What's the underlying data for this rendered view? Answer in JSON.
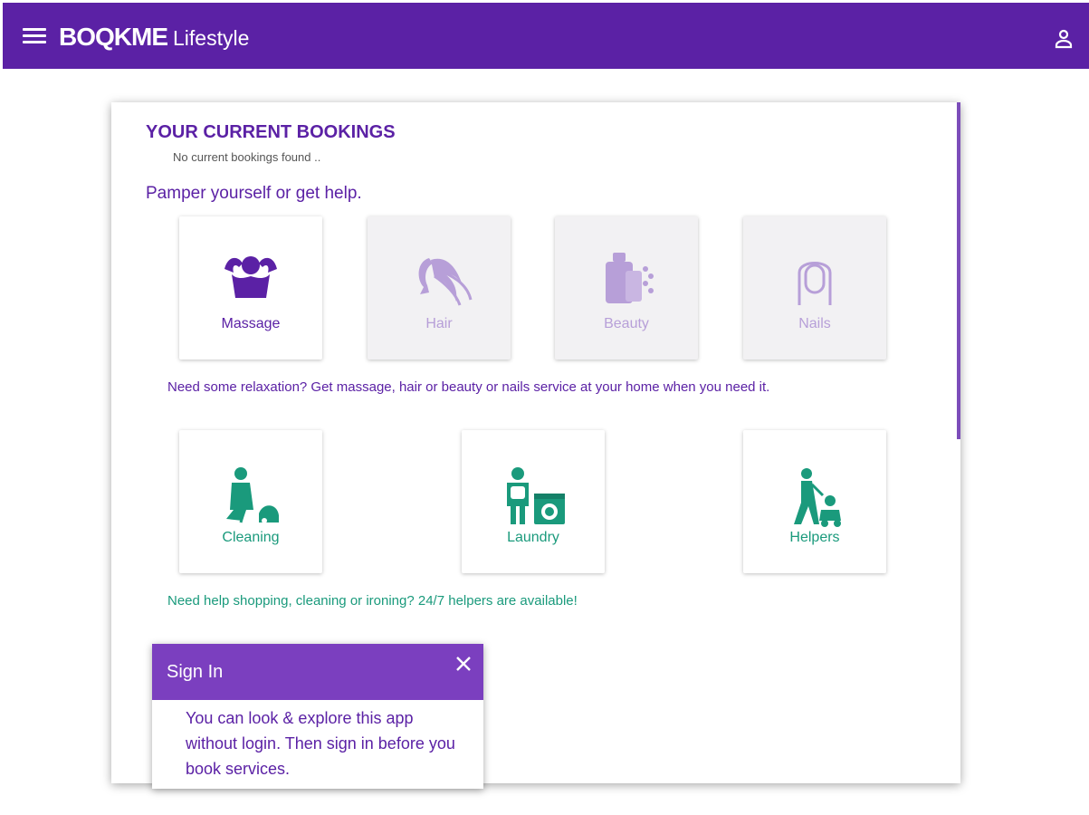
{
  "appbar": {
    "brand": "BOQKME",
    "subtitle": "Lifestyle",
    "menu_icon": "menu-icon",
    "user_icon": "person-icon"
  },
  "bookings": {
    "title": "YOUR CURRENT BOOKINGS",
    "empty_text": "No current bookings found .."
  },
  "pamper": {
    "heading": "Pamper yourself or get help.",
    "tiles": [
      {
        "label": "Massage",
        "icon": "massage-icon",
        "enabled": true
      },
      {
        "label": "Hair",
        "icon": "hair-icon",
        "enabled": false
      },
      {
        "label": "Beauty",
        "icon": "beauty-icon",
        "enabled": false
      },
      {
        "label": "Nails",
        "icon": "nails-icon",
        "enabled": false
      }
    ],
    "description": "Need some relaxation? Get massage, hair or beauty or nails service at your home when you need it."
  },
  "help": {
    "tiles": [
      {
        "label": "Cleaning",
        "icon": "cleaning-icon"
      },
      {
        "label": "Laundry",
        "icon": "laundry-icon"
      },
      {
        "label": "Helpers",
        "icon": "helpers-icon"
      }
    ],
    "description": "Need help shopping, cleaning or ironing? 24/7 helpers are available!"
  },
  "signin_popup": {
    "title": "Sign In",
    "body": "You can look & explore this app without login. Then sign in before you book services."
  },
  "colors": {
    "primary": "#5b21a5",
    "popup_header": "#7b3fbf",
    "green": "#1a9a7c",
    "faded": "#b79fd8"
  }
}
